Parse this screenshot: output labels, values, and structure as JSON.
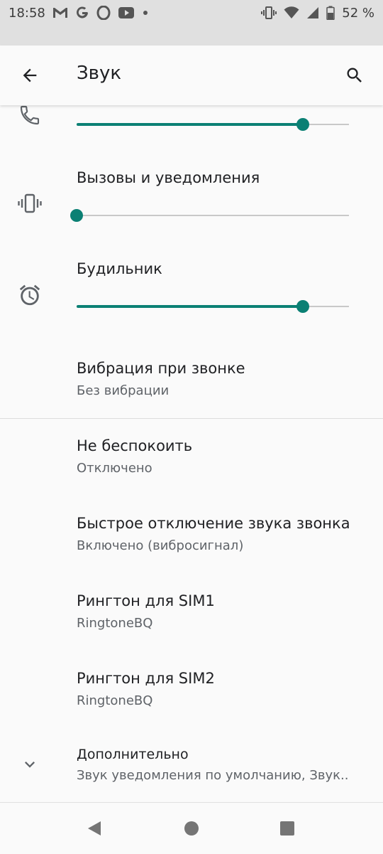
{
  "status_bar": {
    "time": "18:58",
    "battery_percent": "52 %",
    "notification_icons": [
      "gmail-icon",
      "google-icon",
      "opera-icon",
      "youtube-icon",
      "more-dot-icon"
    ],
    "system_icons": [
      "vibrate-icon",
      "wifi-icon",
      "signal-icon",
      "battery-icon"
    ]
  },
  "app_bar": {
    "title": "Звук"
  },
  "volume": {
    "call": {
      "level": 0.83
    },
    "ring_notifications": {
      "label": "Вызовы и уведомления",
      "level": 0.0
    },
    "alarm": {
      "label": "Будильник",
      "level": 0.83
    }
  },
  "settings": {
    "vibrate_on_ring": {
      "title": "Вибрация при звонке",
      "value": "Без вибрации"
    },
    "dnd": {
      "title": "Не беспокоить",
      "value": "Отключено"
    },
    "quick_mute": {
      "title": "Быстрое отключение звука звонка",
      "value": "Включено (вибросигнал)"
    },
    "ringtone_sim1": {
      "title": "Рингтон для SIM1",
      "value": "RingtoneBQ"
    },
    "ringtone_sim2": {
      "title": "Рингтон для SIM2",
      "value": "RingtoneBQ"
    },
    "advanced": {
      "title": "Дополнительно",
      "value": "Звук уведомления по умолчанию, Звук.."
    }
  },
  "colors": {
    "accent": "#0b8074",
    "status_bar_bg": "#e0e0e0",
    "background": "#fafafa"
  }
}
